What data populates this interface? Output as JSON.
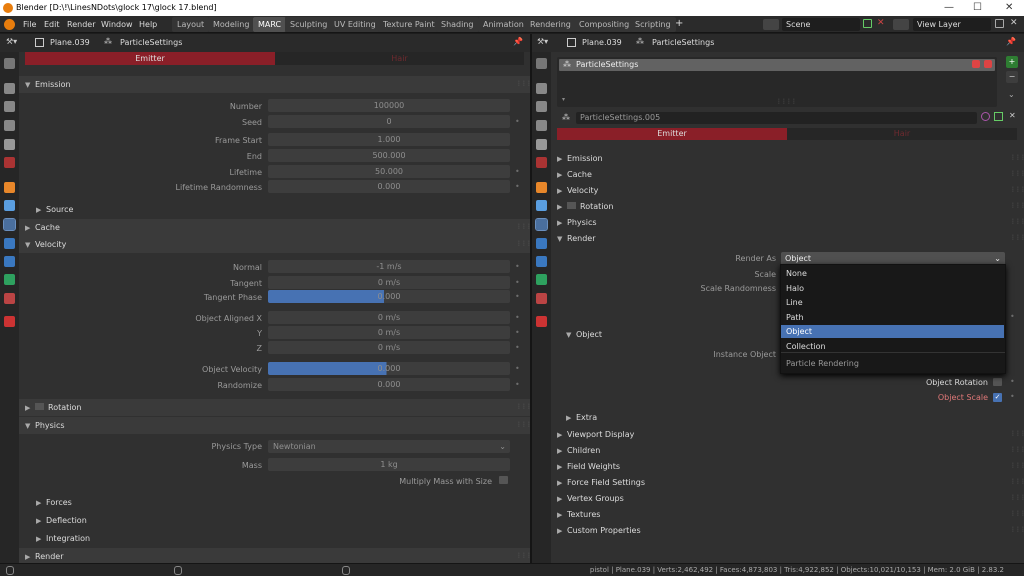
{
  "window": {
    "title": "Blender [D:\\!\\LinesNDots\\glock 17\\glock 17.blend]",
    "minimize": "—",
    "maximize": "☐",
    "close": "✕"
  },
  "menu": [
    "File",
    "Edit",
    "Render",
    "Window",
    "Help"
  ],
  "workspaces": [
    "Layout",
    "Modeling",
    "MARC",
    "Sculpting",
    "UV Editing",
    "Texture Paint",
    "Shading",
    "Animation",
    "Rendering",
    "Compositing",
    "Scripting"
  ],
  "add_workspace": "+",
  "scene": "Scene",
  "view_layer": "View Layer",
  "left": {
    "breadcrumb_object": "Plane.039",
    "breadcrumb_settings": "ParticleSettings",
    "tab_emitter": "Emitter",
    "tab_hair": "Hair",
    "emission": {
      "header": "Emission",
      "rows": [
        {
          "label": "Number",
          "value": "100000"
        },
        {
          "label": "Seed",
          "value": "0"
        },
        {
          "label": "Frame Start",
          "value": "1.000"
        },
        {
          "label": "End",
          "value": "500.000"
        },
        {
          "label": "Lifetime",
          "value": "50.000"
        },
        {
          "label": "Lifetime Randomness",
          "value": "0.000"
        }
      ],
      "source": "Source"
    },
    "cache": "Cache",
    "velocity": {
      "header": "Velocity",
      "rows": [
        {
          "label": "Normal",
          "value": "-1 m/s"
        },
        {
          "label": "Tangent",
          "value": "0 m/s"
        },
        {
          "label": "Tangent Phase",
          "value": "0.000"
        },
        {
          "label": "Object Aligned X",
          "value": "0 m/s"
        },
        {
          "label": "Y",
          "value": "0 m/s"
        },
        {
          "label": "Z",
          "value": "0 m/s"
        },
        {
          "label": "Object Velocity",
          "value": "0.000"
        },
        {
          "label": "Randomize",
          "value": "0.000"
        }
      ]
    },
    "rotation": "Rotation",
    "physics": {
      "header": "Physics",
      "type_label": "Physics Type",
      "type_value": "Newtonian",
      "mass_label": "Mass",
      "mass_value": "1 kg",
      "multiply": "Multiply Mass with Size",
      "forces": "Forces",
      "deflection": "Deflection",
      "integration": "Integration"
    },
    "render": "Render"
  },
  "right": {
    "breadcrumb_object": "Plane.039",
    "breadcrumb_settings": "ParticleSettings",
    "list_item": "ParticleSettings",
    "datablock": "ParticleSettings.005",
    "tab_emitter": "Emitter",
    "tab_hair": "Hair",
    "sections": [
      "Emission",
      "Cache",
      "Velocity",
      "Rotation",
      "Physics",
      "Render"
    ],
    "render_as_label": "Render As",
    "render_as_value": "Object",
    "scale_label": "Scale",
    "scale_rand_label": "Scale Randomness",
    "object_sub": "Object",
    "instance_object_label": "Instance Object",
    "object_rotation": "Object Rotation",
    "object_scale": "Object Scale",
    "extra": "Extra",
    "more_sections": [
      "Viewport Display",
      "Children",
      "Field Weights",
      "Force Field Settings",
      "Vertex Groups",
      "Textures",
      "Custom Properties"
    ],
    "dropdown": {
      "options": [
        "None",
        "Halo",
        "Line",
        "Path",
        "Object",
        "Collection"
      ],
      "selected": "Object",
      "footer": "Particle Rendering"
    }
  },
  "status": "pistol | Plane.039 | Verts:2,462,492 | Faces:4,873,803 | Tris:4,922,852 | Objects:10,021/10,153 | Mem: 2.0 GiB | 2.83.2",
  "colors": {
    "accent_red": "#8a1f28",
    "select_blue": "#4772b3",
    "orange": "#e87d0d"
  }
}
